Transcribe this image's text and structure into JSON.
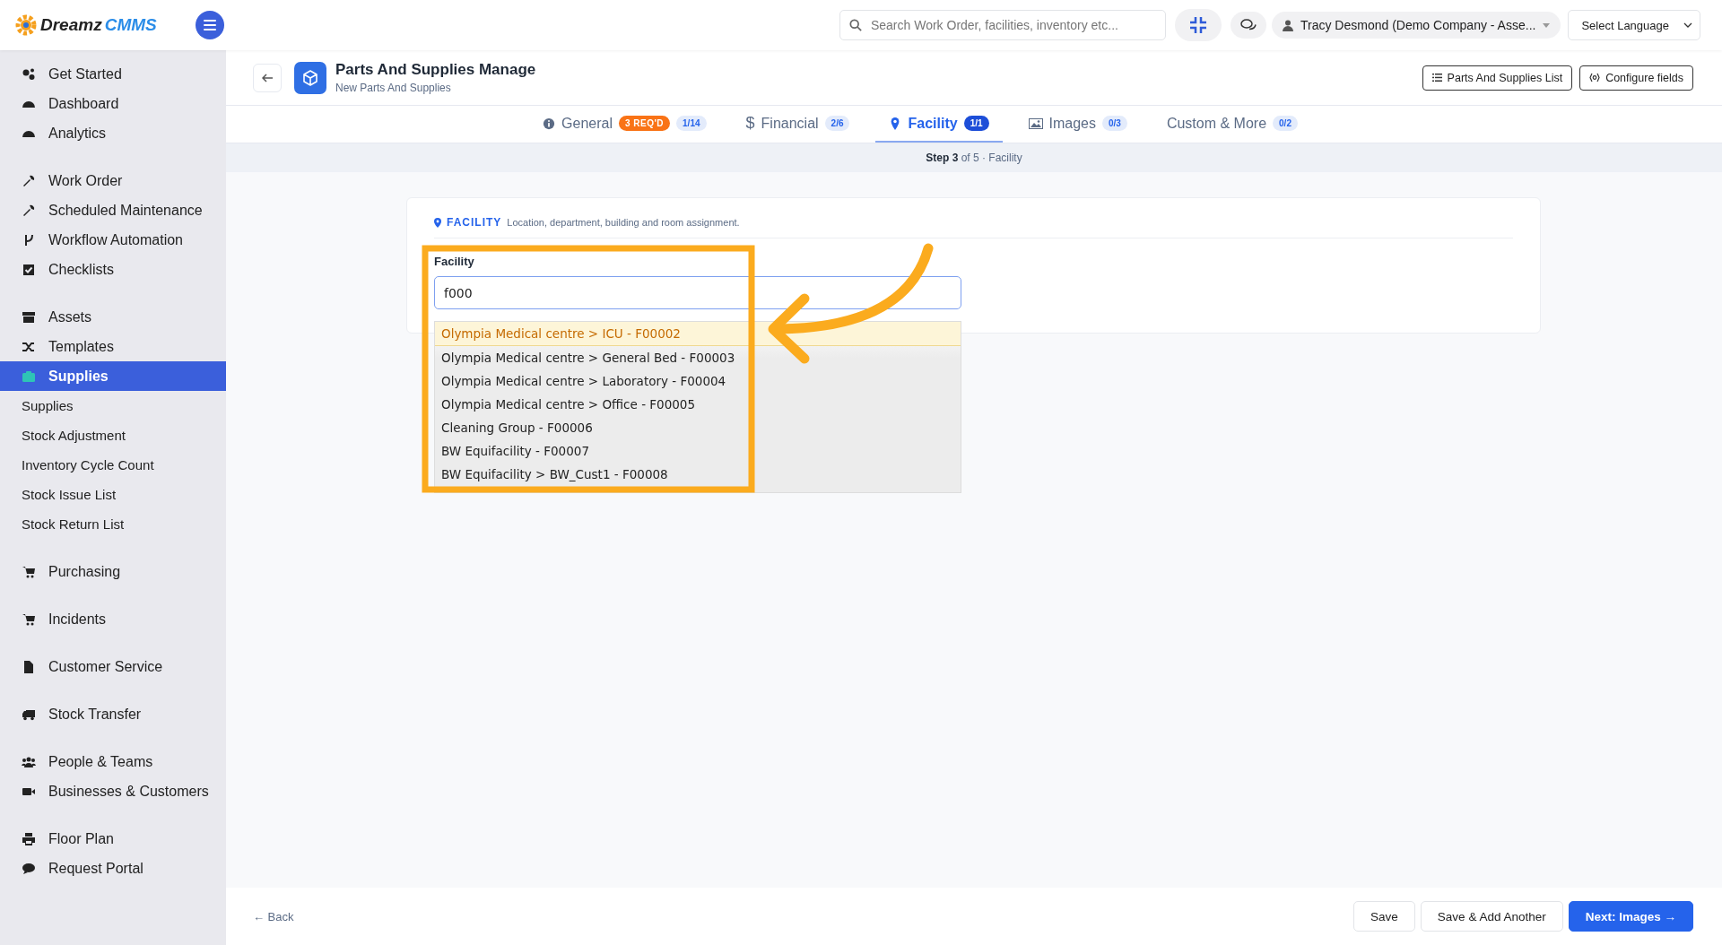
{
  "topbar": {
    "logo": {
      "part1": "Dreamz",
      "part2": "CMMS"
    },
    "search": {
      "placeholder": "Search Work Order, facilities, inventory etc..."
    },
    "user": "Tracy Desmond (Demo Company - Asse...",
    "language": "Select Language"
  },
  "sidebar": {
    "groups": [
      {
        "items": [
          {
            "label": "Get Started",
            "selected": false
          },
          {
            "label": "Dashboard",
            "selected": false
          },
          {
            "label": "Analytics",
            "selected": false
          }
        ]
      },
      {
        "items": [
          {
            "label": "Work Order",
            "selected": false
          },
          {
            "label": "Scheduled Maintenance",
            "selected": false
          },
          {
            "label": "Workflow Automation",
            "selected": false
          },
          {
            "label": "Checklists",
            "selected": false
          }
        ]
      },
      {
        "items": [
          {
            "label": "Assets",
            "selected": false
          },
          {
            "label": "Templates",
            "selected": false
          },
          {
            "label": "Supplies",
            "selected": true,
            "expanded": true,
            "children": [
              {
                "label": "Supplies"
              },
              {
                "label": "Stock Adjustment"
              },
              {
                "label": "Inventory Cycle Count"
              },
              {
                "label": "Stock Issue List"
              },
              {
                "label": "Stock Return List"
              }
            ]
          }
        ]
      },
      {
        "items": [
          {
            "label": "Purchasing",
            "selected": false
          }
        ]
      },
      {
        "items": [
          {
            "label": "Incidents",
            "selected": false
          }
        ]
      },
      {
        "items": [
          {
            "label": "Customer Service",
            "selected": false
          }
        ]
      },
      {
        "items": [
          {
            "label": "Stock Transfer",
            "selected": false
          }
        ]
      },
      {
        "items": [
          {
            "label": "People & Teams",
            "selected": false
          },
          {
            "label": "Businesses & Customers",
            "selected": false
          }
        ]
      },
      {
        "items": [
          {
            "label": "Floor Plan",
            "selected": false
          },
          {
            "label": "Request Portal",
            "selected": false
          }
        ]
      }
    ]
  },
  "header": {
    "title": "Parts And Supplies Manage",
    "subtitle": "New Parts And Supplies",
    "buttons": [
      "Parts And Supplies List",
      "Configure fields"
    ]
  },
  "tabs": [
    {
      "label": "General",
      "selected": false,
      "required": "3 REQ'D",
      "count": "1/14"
    },
    {
      "label": "Financial",
      "symbol": "$",
      "selected": false,
      "count": "2/6"
    },
    {
      "label": "Facility",
      "selected": true,
      "count": "1/1"
    },
    {
      "label": "Images",
      "selected": false,
      "count": "0/3"
    },
    {
      "label": "Custom & More",
      "selected": false,
      "count": "0/2"
    }
  ],
  "step": "**Step 3** of 5 · Facility",
  "section": {
    "title": "FACILITY",
    "description": "Location, department, building and room assignment."
  },
  "field": {
    "label": "Facility",
    "value": "f000",
    "options": [
      {
        "label": "Olympia Medical centre > ICU - F00002",
        "selected": true
      },
      {
        "label": "Olympia Medical centre > General Bed - F00003",
        "selected": false
      },
      {
        "label": "Olympia Medical centre > Laboratory - F00004",
        "selected": false
      },
      {
        "label": "Olympia Medical centre > Office - F00005",
        "selected": false
      },
      {
        "label": "Cleaning Group - F00006",
        "selected": false
      },
      {
        "label": "BW Equifacility - F00007",
        "selected": false
      },
      {
        "label": "BW Equifacility > BW_Cust1 - F00008",
        "selected": false
      }
    ]
  },
  "footer": {
    "back": "← Back",
    "buttons": [
      {
        "label": "Save",
        "kind": "secondary"
      },
      {
        "label": "Save & Add Another",
        "kind": "secondary"
      },
      {
        "label": "Next: Images →",
        "kind": "primary"
      }
    ]
  }
}
